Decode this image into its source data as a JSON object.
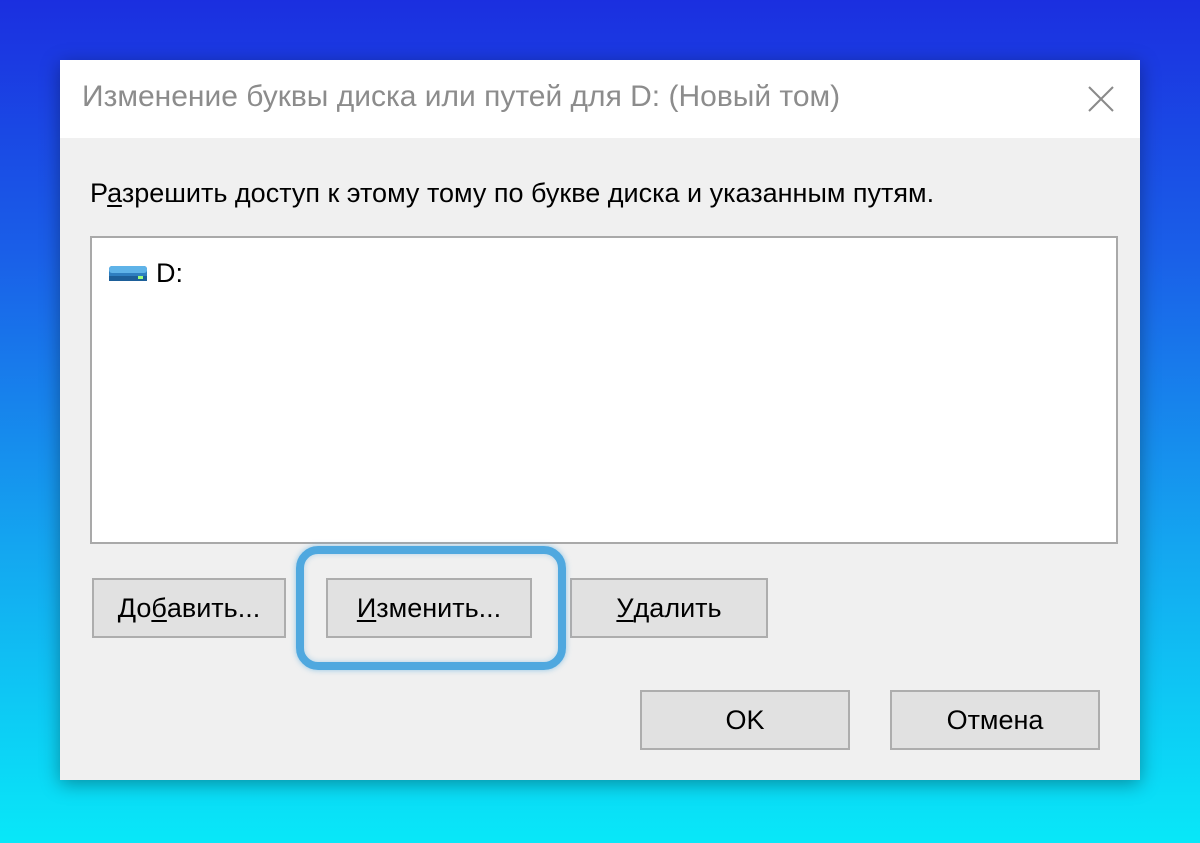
{
  "dialog": {
    "title": "Изменение буквы диска или путей для D: (Новый том)",
    "close_icon": "close-icon"
  },
  "prompt": {
    "mnemonic_prefix": "Р",
    "mnemonic_char": "а",
    "rest": "зрешить доступ к этому тому по букве диска и указанным путям."
  },
  "list": {
    "items": [
      {
        "icon": "drive-icon",
        "label": "D:"
      }
    ]
  },
  "buttons": {
    "add": {
      "prefix": "До",
      "mnemonic": "б",
      "rest": "авить..."
    },
    "change": {
      "prefix": "",
      "mnemonic": "И",
      "rest": "зменить..."
    },
    "remove": {
      "prefix": "",
      "mnemonic": "У",
      "rest": "далить"
    },
    "ok": {
      "label": "OK"
    },
    "cancel": {
      "label": "Отмена"
    }
  },
  "colors": {
    "highlight": "#4fa8df",
    "dialog_bg": "#f0f0f0",
    "button_bg": "#e1e1e1"
  }
}
